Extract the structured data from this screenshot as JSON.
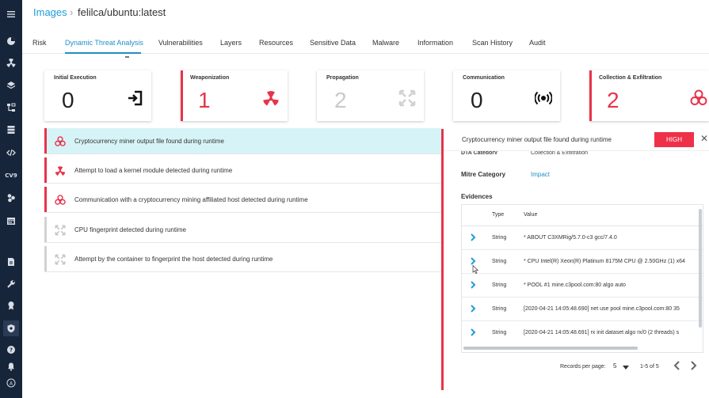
{
  "breadcrumb": {
    "root": "Images",
    "separator": "›",
    "current": "felilca/ubuntu:latest"
  },
  "sidebar": {
    "icons": [
      "menu-icon",
      "dashboard-icon",
      "radiation-icon",
      "layers-icon",
      "network-icon",
      "servers-icon",
      "code-icon",
      "cve-icon",
      "cluster-icon",
      "calendar-icon",
      "report-icon",
      "wrench-icon",
      "badge-icon",
      "shield-icon",
      "help-icon",
      "bell-icon",
      "user-icon"
    ],
    "cve_text": "CV9"
  },
  "tabs": [
    "Risk",
    "Dynamic Threat Analysis",
    "Vulnerabilities",
    "Layers",
    "Resources",
    "Sensitive Data",
    "Malware",
    "Information",
    "Scan History",
    "Audit"
  ],
  "active_tab": "Dynamic Threat Analysis",
  "cards": [
    {
      "title": "Initial Execution",
      "value": "0",
      "icon": "enter-icon"
    },
    {
      "title": "Weaponization",
      "value": "1",
      "icon": "radiation-icon"
    },
    {
      "title": "Propagation",
      "value": "2",
      "icon": "expand-arrows-icon"
    },
    {
      "title": "Communication",
      "value": "0",
      "icon": "broadcast-icon"
    },
    {
      "title": "Collection & Exfiltration",
      "value": "2",
      "icon": "biohazard-icon"
    }
  ],
  "findings": [
    {
      "text": "Cryptocurrency miner output file found during runtime",
      "icon": "biohazard-icon"
    },
    {
      "text": "Attempt to load a kernel module detected during runtime",
      "icon": "radiation-icon"
    },
    {
      "text": "Communication with a cryptocurrency mining affiliated host detected during runtime",
      "icon": "biohazard-icon"
    },
    {
      "text": "CPU fingerprint detected during runtime",
      "icon": "expand-arrows-icon"
    },
    {
      "text": "Attempt by the container to fingerprint the host detected during runtime",
      "icon": "expand-arrows-icon"
    }
  ],
  "detail": {
    "title": "Cryptocurrency miner output file found during runtime",
    "severity": "HIGH",
    "close": "✕",
    "dta_category_label": "DTA Category",
    "dta_category_value": "Collection & Exfiltration",
    "mitre_label": "Mitre Category",
    "mitre_value": "Impact",
    "evidences_label": "Evidences",
    "columns": {
      "type": "Type",
      "value": "Value"
    },
    "rows": [
      {
        "type": "String",
        "value": "* ABOUT C3XMRig/5.7.0-c3 gcc/7.4.0"
      },
      {
        "type": "String",
        "value": "* CPU Intel(R) Xeon(R) Platinum 8175M CPU @ 2.50GHz (1) x64"
      },
      {
        "type": "String",
        "value": "* POOL #1 mine.c3pool.com:80 algo auto"
      },
      {
        "type": "String",
        "value": "[2020-04-21 14:05:48.690] net use pool mine.c3pool.com:80 35"
      },
      {
        "type": "String",
        "value": "[2020-04-21 14:05:48.691] rx init dataset algo rx/0 (2 threads) s"
      }
    ],
    "pager": {
      "label": "Records per page:",
      "per_page": "5",
      "range": "1-5 of 5"
    }
  },
  "colors": {
    "accent": "#1f8fc7",
    "danger": "#e8334a",
    "selected_row": "#d6f4f7",
    "sidebar": "#17253a"
  }
}
